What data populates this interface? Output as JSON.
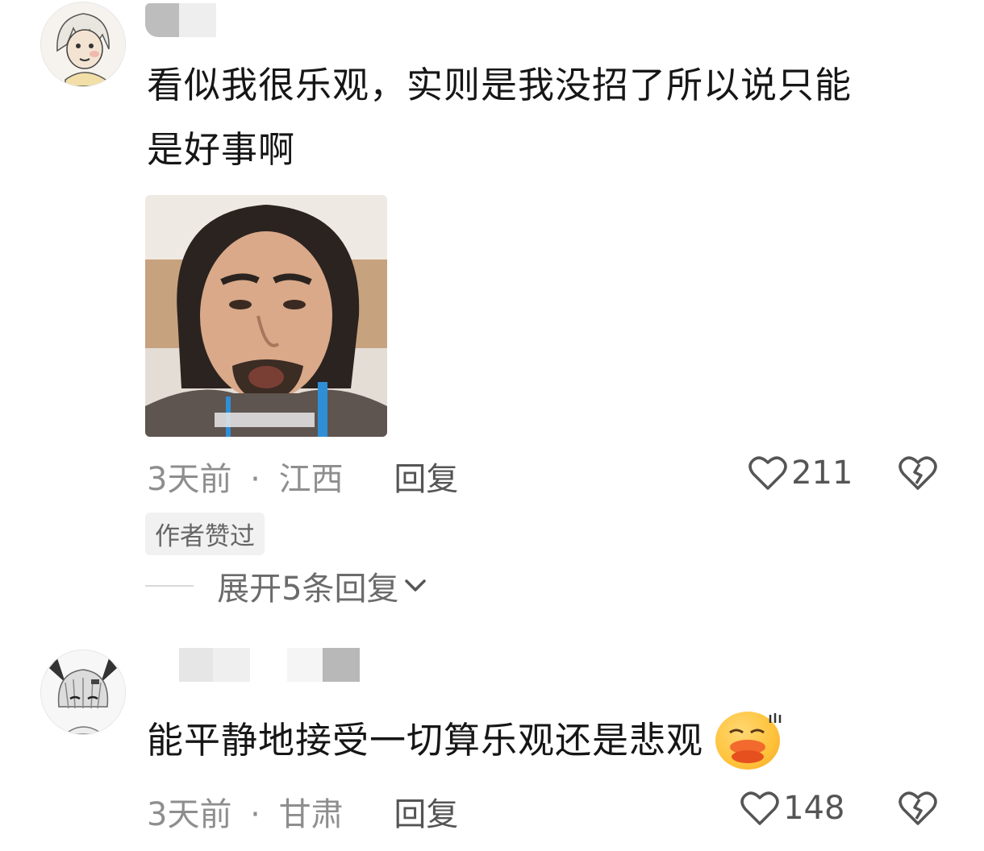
{
  "comments": [
    {
      "text": "看似我很乐观，实则是我没招了所以说只能是好事啊",
      "text_line1": "看似我很乐观，实则是我没招了所以说只能",
      "text_line2": "是好事啊",
      "image_caption": "[__________]",
      "time": "3天前",
      "separator": "·",
      "location": "江西",
      "reply_label": "回复",
      "likes": "211",
      "author_badge": "作者赞过",
      "expand_label": "展开5条回复"
    },
    {
      "text": "能平静地接受一切算乐观还是悲观",
      "time": "3天前",
      "separator": "·",
      "location": "甘肃",
      "reply_label": "回复",
      "likes": "148"
    }
  ],
  "icons": {
    "like": "heart-outline-icon",
    "dislike": "broken-heart-icon",
    "expand": "chevron-down-icon",
    "emoji": "duck-lips-emoji-icon"
  },
  "colors": {
    "meta_gray": "#8e8e8e",
    "text": "#161616",
    "pill_bg": "#f1f1f1"
  }
}
